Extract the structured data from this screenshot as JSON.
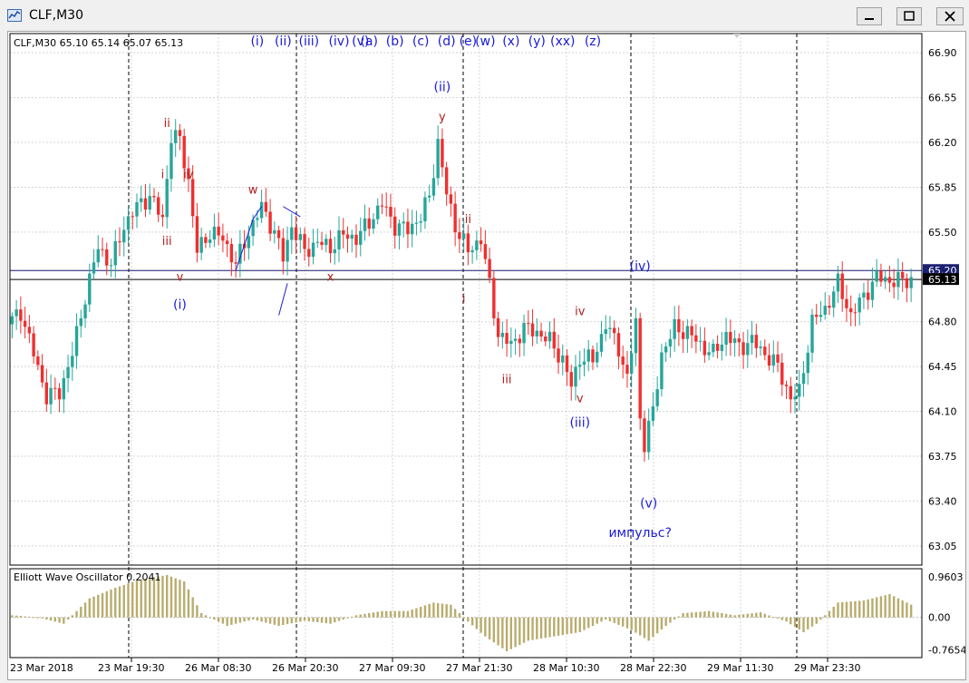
{
  "window": {
    "title": "CLF,M30"
  },
  "chart_data": {
    "type": "candlestick",
    "symbol_label": "CLF,M30",
    "ohlc": {
      "open": "65.10",
      "high": "65.14",
      "low": "65.07",
      "close": "65.13"
    },
    "y_ticks": [
      "66.90",
      "66.55",
      "66.20",
      "65.85",
      "65.50",
      "65.20",
      "64.80",
      "64.45",
      "64.10",
      "63.75",
      "63.40",
      "63.05"
    ],
    "ylim": [
      62.9,
      67.05
    ],
    "x_ticks": [
      "23 Mar 2018",
      "23 Mar 19:30",
      "26 Mar 08:30",
      "26 Mar 20:30",
      "27 Mar 09:30",
      "27 Mar 21:30",
      "28 Mar 10:30",
      "28 Mar 22:30",
      "29 Mar 11:30",
      "29 Mar 23:30"
    ],
    "horizontal_lines": [
      {
        "value": 65.2,
        "label": "65.20",
        "color": "#1b2070"
      },
      {
        "value": 65.13,
        "label": "65.13",
        "color": "#000000"
      }
    ],
    "colors": {
      "bull": "#26a69a",
      "bear": "#ef2f2f",
      "wave_blue": "#1a1ad8",
      "wave_red": "#b02020"
    },
    "waypoints": [
      [
        0,
        64.78
      ],
      [
        3,
        64.88
      ],
      [
        6,
        64.55
      ],
      [
        9,
        64.22
      ],
      [
        12,
        64.25
      ],
      [
        15,
        64.55
      ],
      [
        18,
        65.0
      ],
      [
        21,
        65.38
      ],
      [
        24,
        65.25
      ],
      [
        27,
        65.55
      ],
      [
        30,
        65.7
      ],
      [
        33,
        65.78
      ],
      [
        36,
        65.6
      ],
      [
        38,
        66.25
      ],
      [
        40,
        66.22
      ],
      [
        42,
        65.9
      ],
      [
        44,
        65.35
      ],
      [
        47,
        65.5
      ],
      [
        50,
        65.45
      ],
      [
        53,
        65.25
      ],
      [
        56,
        65.5
      ],
      [
        59,
        65.7
      ],
      [
        62,
        65.5
      ],
      [
        64,
        65.3
      ],
      [
        66,
        65.55
      ],
      [
        69,
        65.35
      ],
      [
        72,
        65.42
      ],
      [
        75,
        65.38
      ],
      [
        78,
        65.48
      ],
      [
        81,
        65.45
      ],
      [
        84,
        65.58
      ],
      [
        87,
        65.72
      ],
      [
        90,
        65.55
      ],
      [
        93,
        65.52
      ],
      [
        96,
        65.62
      ],
      [
        98,
        65.78
      ],
      [
        100,
        66.2
      ],
      [
        102,
        65.8
      ],
      [
        104,
        65.55
      ],
      [
        107,
        65.35
      ],
      [
        110,
        65.45
      ],
      [
        112,
        65.08
      ],
      [
        114,
        64.7
      ],
      [
        117,
        64.62
      ],
      [
        120,
        64.75
      ],
      [
        123,
        64.72
      ],
      [
        126,
        64.65
      ],
      [
        129,
        64.5
      ],
      [
        131,
        64.3
      ],
      [
        133,
        64.52
      ],
      [
        136,
        64.5
      ],
      [
        139,
        64.78
      ],
      [
        142,
        64.6
      ],
      [
        144,
        64.35
      ],
      [
        146,
        64.8
      ],
      [
        147,
        64.05
      ],
      [
        148,
        63.85
      ],
      [
        150,
        64.1
      ],
      [
        152,
        64.55
      ],
      [
        155,
        64.75
      ],
      [
        158,
        64.72
      ],
      [
        161,
        64.62
      ],
      [
        164,
        64.55
      ],
      [
        167,
        64.7
      ],
      [
        170,
        64.6
      ],
      [
        173,
        64.65
      ],
      [
        176,
        64.55
      ],
      [
        179,
        64.45
      ],
      [
        182,
        64.2
      ],
      [
        184,
        64.25
      ],
      [
        187,
        64.8
      ],
      [
        190,
        64.9
      ],
      [
        193,
        65.1
      ],
      [
        196,
        64.85
      ],
      [
        199,
        65.0
      ],
      [
        202,
        65.15
      ],
      [
        205,
        65.12
      ],
      [
        208,
        65.12
      ],
      [
        210,
        65.13
      ]
    ],
    "wave_labels_top": [
      {
        "text": "(i)",
        "x": 57
      },
      {
        "text": "(ii)",
        "x": 63
      },
      {
        "text": "(iii)",
        "x": 69
      },
      {
        "text": "(iv)",
        "x": 76
      },
      {
        "text": "(v)",
        "x": 81
      },
      {
        "text": "(a)",
        "x": 83
      },
      {
        "text": "(b)",
        "x": 89
      },
      {
        "text": "(c)",
        "x": 95
      },
      {
        "text": "(d)",
        "x": 101
      },
      {
        "text": "(e)",
        "x": 106
      },
      {
        "text": "(w)",
        "x": 110
      },
      {
        "text": "(x)",
        "x": 116
      },
      {
        "text": "(y)",
        "x": 122
      },
      {
        "text": "(xx)",
        "x": 128
      },
      {
        "text": "(z)",
        "x": 135
      }
    ],
    "wave_labels": [
      {
        "text": "ii",
        "x": 36,
        "y": 66.32,
        "c": "red"
      },
      {
        "text": "i",
        "x": 35,
        "y": 65.92,
        "c": "red"
      },
      {
        "text": "iv",
        "x": 41,
        "y": 65.92,
        "c": "red"
      },
      {
        "text": "iii",
        "x": 36,
        "y": 65.4,
        "c": "red"
      },
      {
        "text": "v",
        "x": 39,
        "y": 65.12,
        "c": "red"
      },
      {
        "text": "(i)",
        "x": 39,
        "y": 64.9,
        "c": "blue"
      },
      {
        "text": "w",
        "x": 56,
        "y": 65.8,
        "c": "red"
      },
      {
        "text": "x",
        "x": 74,
        "y": 65.12,
        "c": "red"
      },
      {
        "text": "(ii)",
        "x": 100,
        "y": 66.6,
        "c": "blue"
      },
      {
        "text": "y",
        "x": 100,
        "y": 66.37,
        "c": "red"
      },
      {
        "text": "ii",
        "x": 106,
        "y": 65.57,
        "c": "red"
      },
      {
        "text": "i",
        "x": 105,
        "y": 64.95,
        "c": "red"
      },
      {
        "text": "iii",
        "x": 115,
        "y": 64.32,
        "c": "red"
      },
      {
        "text": "iv",
        "x": 132,
        "y": 64.85,
        "c": "red"
      },
      {
        "text": "v",
        "x": 132,
        "y": 64.17,
        "c": "red"
      },
      {
        "text": "(iii)",
        "x": 132,
        "y": 63.98,
        "c": "blue"
      },
      {
        "text": "(iv)",
        "x": 146,
        "y": 65.2,
        "c": "blue"
      },
      {
        "text": "(v)",
        "x": 148,
        "y": 63.35,
        "c": "blue"
      },
      {
        "text": "импульс?",
        "x": 146,
        "y": 63.12,
        "c": "blue"
      }
    ],
    "oscillator": {
      "label": "Elliott Wave Oscillator 0.2041",
      "y_ticks": [
        "0.9603",
        "0.00",
        "-0.7654"
      ],
      "ylim": [
        -0.95,
        1.15
      ],
      "waypoints": [
        [
          0,
          0.05
        ],
        [
          6,
          0.0
        ],
        [
          12,
          -0.15
        ],
        [
          18,
          0.45
        ],
        [
          24,
          0.7
        ],
        [
          30,
          0.9
        ],
        [
          36,
          1.0
        ],
        [
          40,
          0.85
        ],
        [
          44,
          0.1
        ],
        [
          50,
          -0.2
        ],
        [
          56,
          -0.05
        ],
        [
          62,
          -0.2
        ],
        [
          68,
          -0.08
        ],
        [
          74,
          -0.15
        ],
        [
          80,
          0.05
        ],
        [
          86,
          0.15
        ],
        [
          92,
          0.15
        ],
        [
          98,
          0.35
        ],
        [
          102,
          0.3
        ],
        [
          106,
          -0.1
        ],
        [
          110,
          -0.45
        ],
        [
          115,
          -0.8
        ],
        [
          120,
          -0.55
        ],
        [
          126,
          -0.45
        ],
        [
          132,
          -0.35
        ],
        [
          138,
          -0.05
        ],
        [
          144,
          -0.3
        ],
        [
          148,
          -0.55
        ],
        [
          152,
          -0.2
        ],
        [
          156,
          0.1
        ],
        [
          162,
          0.15
        ],
        [
          168,
          0.05
        ],
        [
          174,
          0.12
        ],
        [
          180,
          -0.1
        ],
        [
          184,
          -0.35
        ],
        [
          187,
          -0.15
        ],
        [
          192,
          0.35
        ],
        [
          198,
          0.4
        ],
        [
          204,
          0.55
        ],
        [
          210,
          0.25
        ]
      ]
    }
  }
}
